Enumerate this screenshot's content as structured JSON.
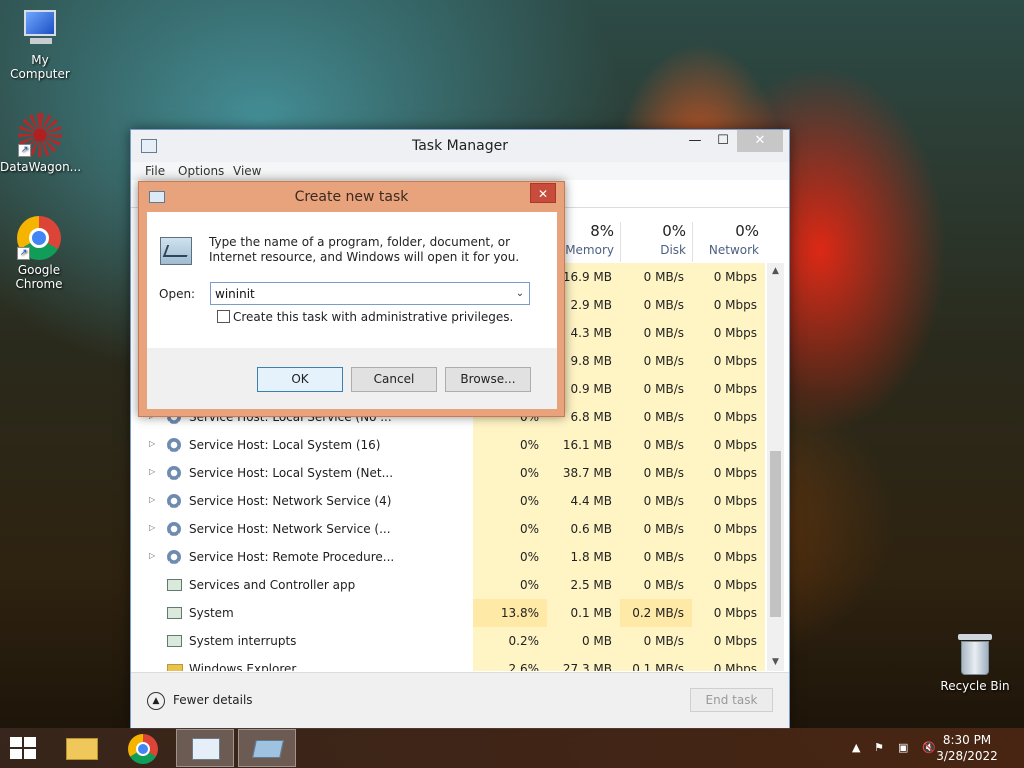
{
  "desktop": {
    "icons": [
      {
        "label": "My Computer"
      },
      {
        "label": "DataWagon..."
      },
      {
        "label": "Google Chrome"
      },
      {
        "label": "Recycle Bin"
      }
    ]
  },
  "task_manager": {
    "title": "Task Manager",
    "menu": [
      "File",
      "Options",
      "View"
    ],
    "columns": [
      {
        "pct": "8%",
        "label": "Memory"
      },
      {
        "pct": "0%",
        "label": "Disk"
      },
      {
        "pct": "0%",
        "label": "Network"
      }
    ],
    "rows": [
      {
        "name": "",
        "cpu": "",
        "mem": "16.9 MB",
        "disk": "0 MB/s",
        "net": "0 Mbps"
      },
      {
        "name": "",
        "cpu": "",
        "mem": "2.9 MB",
        "disk": "0 MB/s",
        "net": "0 Mbps"
      },
      {
        "name": "",
        "cpu": "",
        "mem": "4.3 MB",
        "disk": "0 MB/s",
        "net": "0 Mbps"
      },
      {
        "name": "",
        "cpu": "",
        "mem": "9.8 MB",
        "disk": "0 MB/s",
        "net": "0 Mbps"
      },
      {
        "name": "",
        "cpu": "",
        "mem": "0.9 MB",
        "disk": "0 MB/s",
        "net": "0 Mbps"
      },
      {
        "name": "Service Host: Local Service (No ...",
        "cpu": "0%",
        "mem": "6.8 MB",
        "disk": "0 MB/s",
        "net": "0 Mbps"
      },
      {
        "name": "Service Host: Local System (16)",
        "cpu": "0%",
        "mem": "16.1 MB",
        "disk": "0 MB/s",
        "net": "0 Mbps"
      },
      {
        "name": "Service Host: Local System (Net...",
        "cpu": "0%",
        "mem": "38.7 MB",
        "disk": "0 MB/s",
        "net": "0 Mbps"
      },
      {
        "name": "Service Host: Network Service (4)",
        "cpu": "0%",
        "mem": "4.4 MB",
        "disk": "0 MB/s",
        "net": "0 Mbps"
      },
      {
        "name": "Service Host: Network Service (...",
        "cpu": "0%",
        "mem": "0.6 MB",
        "disk": "0 MB/s",
        "net": "0 Mbps"
      },
      {
        "name": "Service Host: Remote Procedure...",
        "cpu": "0%",
        "mem": "1.8 MB",
        "disk": "0 MB/s",
        "net": "0 Mbps"
      },
      {
        "name": "Services and Controller app",
        "cpu": "0%",
        "mem": "2.5 MB",
        "disk": "0 MB/s",
        "net": "0 Mbps"
      },
      {
        "name": "System",
        "cpu": "13.8%",
        "mem": "0.1 MB",
        "disk": "0.2 MB/s",
        "net": "0 Mbps"
      },
      {
        "name": "System interrupts",
        "cpu": "0.2%",
        "mem": "0 MB",
        "disk": "0 MB/s",
        "net": "0 Mbps"
      },
      {
        "name": "Windows Explorer",
        "cpu": "2.6%",
        "mem": "27.3 MB",
        "disk": "0.1 MB/s",
        "net": "0 Mbps"
      }
    ],
    "footer": {
      "fewer_details": "Fewer details",
      "end_task": "End task"
    }
  },
  "dialog": {
    "title": "Create new task",
    "description": "Type the name of a program, folder, document, or Internet resource, and Windows will open it for you.",
    "open_label": "Open:",
    "open_value": "wininit",
    "admin_label": "Create this task with administrative privileges.",
    "ok": "OK",
    "cancel": "Cancel",
    "browse": "Browse..."
  },
  "taskbar": {
    "time": "8:30 PM",
    "date": "3/28/2022"
  }
}
